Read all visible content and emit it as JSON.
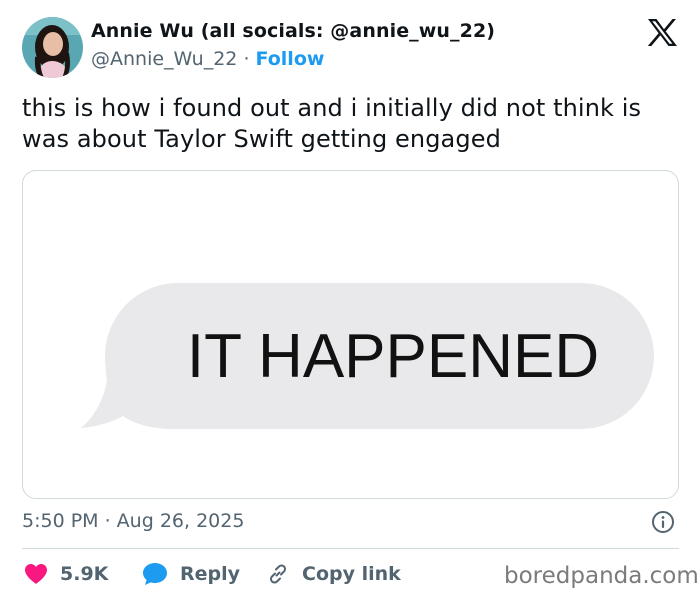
{
  "author": {
    "name": "Annie Wu (all socials: @annie_wu_22)",
    "handle": "@Annie_Wu_22",
    "separator": "·",
    "follow_label": "Follow"
  },
  "tweet": {
    "text": "this is how i found out and i initially did not think is was about Taylor Swift getting engaged",
    "image_text": "IT HAPPENED",
    "timestamp": "5:50 PM · Aug 26, 2025"
  },
  "actions": {
    "likes_count": "5.9K",
    "reply_label": "Reply",
    "copy_link_label": "Copy link"
  },
  "watermark": "boredpanda.com",
  "icons": {
    "x_logo": "x-logo-icon",
    "info": "info-icon",
    "like": "heart-icon",
    "reply": "speech-bubble-icon",
    "copy_link": "link-icon"
  },
  "colors": {
    "follow_blue": "#1d9bf0",
    "heart_red": "#f91880",
    "reply_blue": "#1d9bf0",
    "secondary_text": "#536471",
    "bubble_gray": "#e9e9eb"
  }
}
